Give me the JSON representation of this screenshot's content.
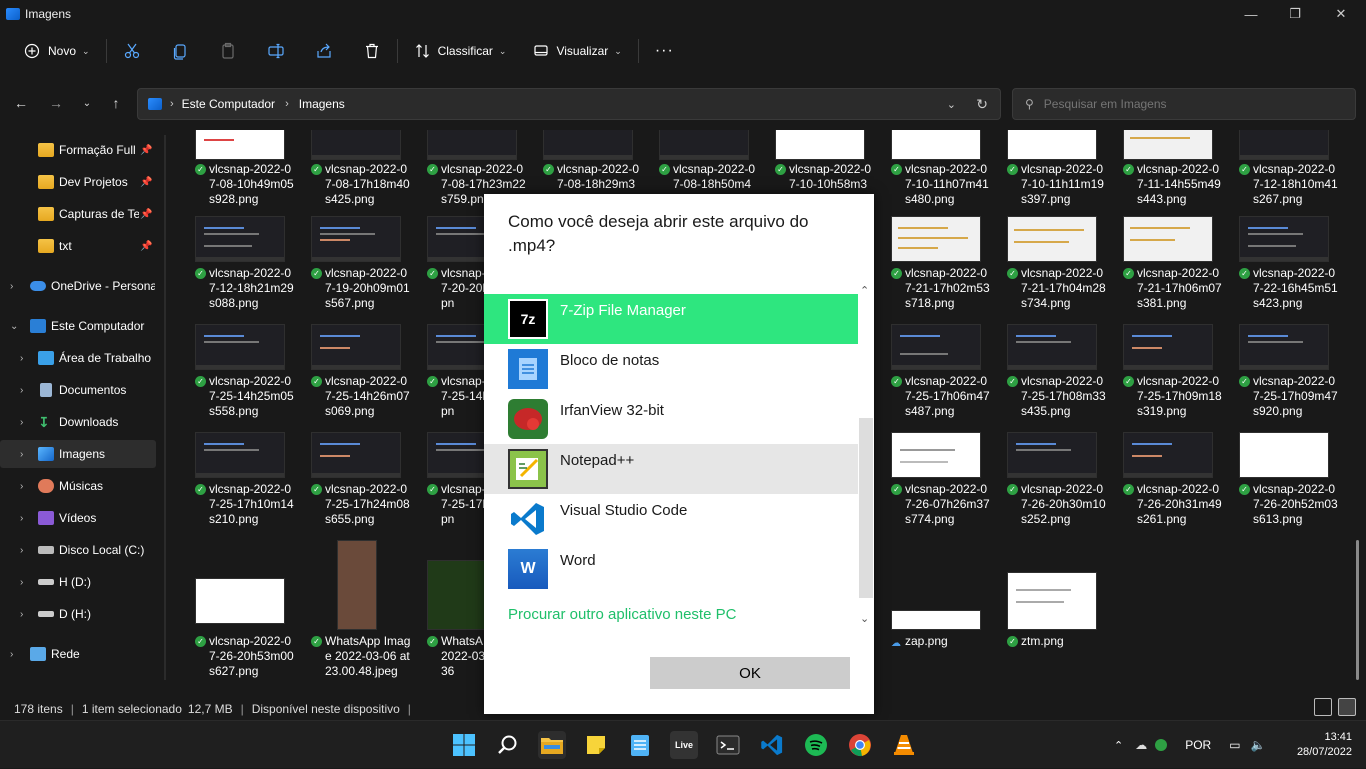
{
  "window": {
    "title": "Imagens"
  },
  "toolbar": {
    "new_label": "Novo",
    "sort_label": "Classificar",
    "view_label": "Visualizar",
    "more_label": "···"
  },
  "address": {
    "crumbs": [
      "Este Computador",
      "Imagens"
    ],
    "search_placeholder": "Pesquisar em Imagens"
  },
  "sidebar": {
    "items": [
      {
        "label": "Formação Full",
        "pinned": true
      },
      {
        "label": "Dev Projetos",
        "pinned": true
      },
      {
        "label": "Capturas de Tel",
        "pinned": true
      },
      {
        "label": "txt",
        "pinned": true
      },
      {
        "label": "OneDrive - Persona"
      },
      {
        "label": "Este Computador"
      },
      {
        "label": "Área de Trabalho"
      },
      {
        "label": "Documentos"
      },
      {
        "label": "Downloads"
      },
      {
        "label": "Imagens"
      },
      {
        "label": "Músicas"
      },
      {
        "label": "Vídeos"
      },
      {
        "label": "Disco Local (C:)"
      },
      {
        "label": "H (D:)"
      },
      {
        "label": "D (H:)"
      },
      {
        "label": "Rede"
      }
    ]
  },
  "files": {
    "row1": [
      "vlcsnap-2022-07-08-10h49m05s928.png",
      "vlcsnap-2022-07-08-17h18m40s425.png",
      "vlcsnap-2022-07-08-17h23m22s759.png",
      "vlcsnap-2022-07-08-18h29m3",
      "vlcsnap-2022-07-08-18h50m4",
      "vlcsnap-2022-07-10-10h58m3",
      "vlcsnap-2022-07-10-11h07m41s480.png",
      "vlcsnap-2022-07-10-11h11m19s397.png",
      "vlcsnap-2022-07-11-14h55m49s443.png",
      "vlcsnap-2022-07-12-18h10m41s267.png"
    ],
    "row2": [
      "vlcsnap-2022-07-12-18h21m29s088.png",
      "vlcsnap-2022-07-19-20h09m01s567.png",
      "vlcsnap-2022-07-20-20h3s533.pn",
      "vlcsnap-2022-07-21-17h02m53s718.png",
      "vlcsnap-2022-07-21-17h04m28s734.png",
      "vlcsnap-2022-07-21-17h06m07s381.png",
      "vlcsnap-2022-07-22-16h45m51s423.png"
    ],
    "row3": [
      "vlcsnap-2022-07-25-14h25m05s558.png",
      "vlcsnap-2022-07-25-14h26m07s069.png",
      "vlcsnap-2022-07-25-14h8s244.pn",
      "vlcsnap-2022-07-25-17h06m47s487.png",
      "vlcsnap-2022-07-25-17h08m33s435.png",
      "vlcsnap-2022-07-25-17h09m18s319.png",
      "vlcsnap-2022-07-25-17h09m47s920.png"
    ],
    "row4": [
      "vlcsnap-2022-07-25-17h10m14s210.png",
      "vlcsnap-2022-07-25-17h24m08s655.png",
      "vlcsnap-2022-07-25-17h4s217.pn",
      "vlcsnap-2022-07-26-07h26m37s774.png",
      "vlcsnap-2022-07-26-20h30m10s252.png",
      "vlcsnap-2022-07-26-20h31m49s261.png",
      "vlcsnap-2022-07-26-20h52m03s613.png"
    ],
    "row5": [
      "vlcsnap-2022-07-26-20h53m00s627.png",
      "WhatsApp Image 2022-03-06 at 23.00.48.jpeg",
      "WhatsA Image 2022-03 12.29.36",
      "zap.png",
      "ztm.png"
    ]
  },
  "status": {
    "count": "178 itens",
    "selected": "1 item selecionado",
    "size": "12,7 MB",
    "availability": "Disponível neste dispositivo"
  },
  "dialog": {
    "title": "Como você deseja abrir este arquivo do .mp4?",
    "apps": [
      {
        "name": "7-Zip File Manager",
        "icon": "7z"
      },
      {
        "name": "Bloco de notas",
        "icon": "notepad-icon"
      },
      {
        "name": "IrfanView 32-bit",
        "icon": "irfanview-icon"
      },
      {
        "name": "Notepad++",
        "icon": "notepadpp-icon"
      },
      {
        "name": "Visual Studio Code",
        "icon": "vscode-icon"
      },
      {
        "name": "Word",
        "icon": "W"
      }
    ],
    "other_link": "Procurar outro aplicativo neste PC",
    "ok_label": "OK",
    "accent": "#2ee67f"
  },
  "taskbar": {
    "live_label": "Live",
    "language": "POR",
    "time": "13:41",
    "date": "28/07/2022"
  }
}
